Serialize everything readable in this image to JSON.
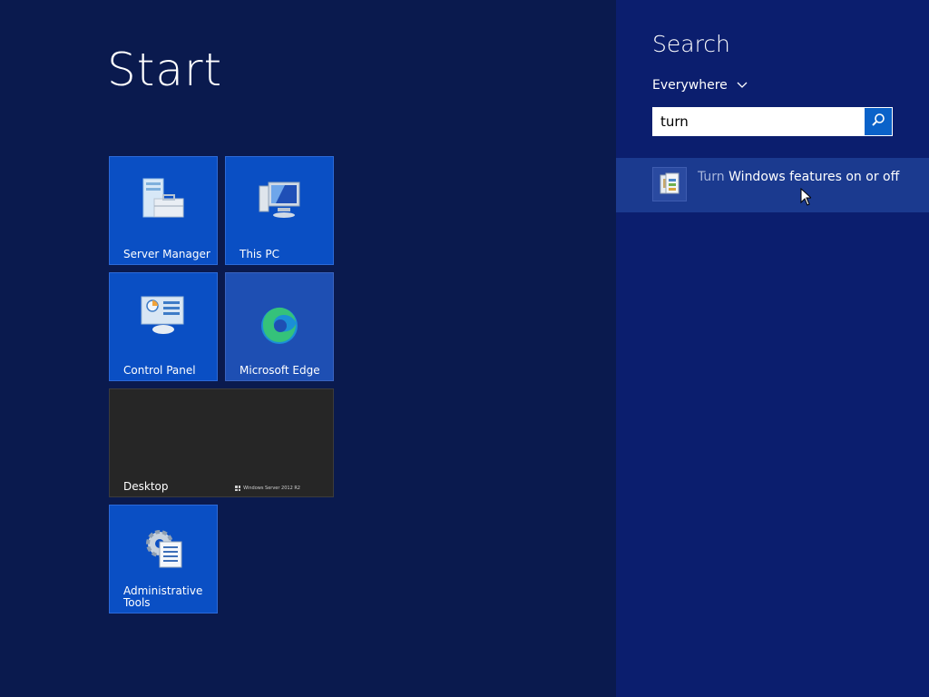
{
  "start": {
    "title": "Start"
  },
  "tiles": {
    "server_manager": "Server Manager",
    "this_pc": "This PC",
    "control_panel": "Control Panel",
    "microsoft_edge": "Microsoft Edge",
    "desktop": "Desktop",
    "desktop_watermark": "Windows Server 2012 R2",
    "administrative_tools": "Administrative\nTools"
  },
  "search": {
    "title": "Search",
    "scope": "Everywhere",
    "query": "turn",
    "results": [
      {
        "match": "Turn",
        "rest": " Windows features on or off"
      }
    ]
  },
  "colors": {
    "background": "#0a1a4e",
    "search_pane": "#0b1e6e",
    "tile_blue": "#0a4fc4",
    "desktop_tile": "#262626",
    "result_highlight": "#1b3a8f",
    "search_button": "#0a62c9"
  },
  "icons": {
    "scope": "chevron-down-icon",
    "search": "magnifier-icon",
    "result": "windows-features-icon"
  }
}
